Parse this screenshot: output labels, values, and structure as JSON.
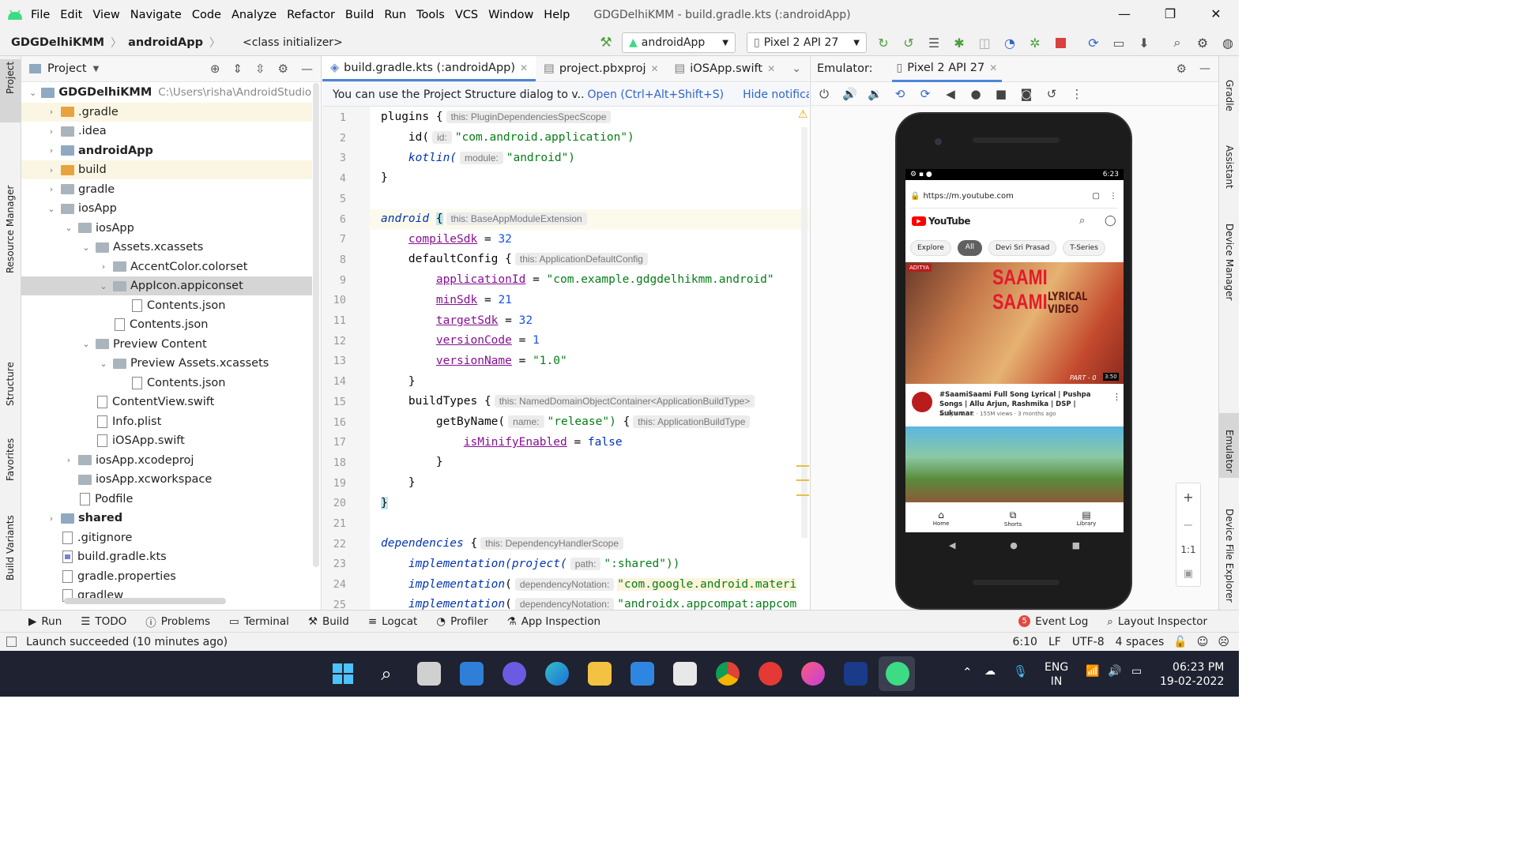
{
  "menu": [
    "File",
    "Edit",
    "View",
    "Navigate",
    "Code",
    "Analyze",
    "Refactor",
    "Build",
    "Run",
    "Tools",
    "VCS",
    "Window",
    "Help"
  ],
  "window_title": "GDGDelhiKMM - build.gradle.kts (:androidApp)",
  "breadcrumb": {
    "project": "GDGDelhiKMM",
    "module": "androidApp",
    "context": "<class initializer>"
  },
  "toolbar": {
    "run_config": "androidApp",
    "device": "Pixel 2 API 27"
  },
  "left_tabs": [
    "Project",
    "Resource Manager",
    "Structure",
    "Favorites",
    "Build Variants"
  ],
  "right_tabs": [
    "Gradle",
    "Assistant",
    "Device Manager",
    "Emulator",
    "Device File Explorer"
  ],
  "project_panel": {
    "title": "Project",
    "tree": [
      {
        "label": "GDGDelhiKMM",
        "path": "C:\\Users\\risha\\AndroidStudioProj",
        "indent": 0,
        "type": "module",
        "bold": true,
        "arrow": "⌄"
      },
      {
        "label": ".gradle",
        "indent": 1,
        "type": "orange",
        "arrow": "›"
      },
      {
        "label": ".idea",
        "indent": 1,
        "type": "folder",
        "arrow": "›"
      },
      {
        "label": "androidApp",
        "indent": 1,
        "type": "module",
        "bold": true,
        "arrow": "›"
      },
      {
        "label": "build",
        "indent": 1,
        "type": "orange",
        "arrow": "›"
      },
      {
        "label": "gradle",
        "indent": 1,
        "type": "folder",
        "arrow": "›"
      },
      {
        "label": "iosApp",
        "indent": 1,
        "type": "folder",
        "arrow": "⌄"
      },
      {
        "label": "iosApp",
        "indent": 2,
        "type": "folder",
        "arrow": "⌄"
      },
      {
        "label": "Assets.xcassets",
        "indent": 3,
        "type": "folder",
        "arrow": "⌄"
      },
      {
        "label": "AccentColor.colorset",
        "indent": 4,
        "type": "folder",
        "arrow": "›"
      },
      {
        "label": "AppIcon.appiconset",
        "indent": 4,
        "type": "folder",
        "arrow": "⌄",
        "selected": true
      },
      {
        "label": "Contents.json",
        "indent": 5,
        "type": "file",
        "arrow": ""
      },
      {
        "label": "Contents.json",
        "indent": 4,
        "type": "file",
        "arrow": ""
      },
      {
        "label": "Preview Content",
        "indent": 3,
        "type": "folder",
        "arrow": "⌄"
      },
      {
        "label": "Preview Assets.xcassets",
        "indent": 4,
        "type": "folder",
        "arrow": "⌄"
      },
      {
        "label": "Contents.json",
        "indent": 5,
        "type": "file",
        "arrow": ""
      },
      {
        "label": "ContentView.swift",
        "indent": 3,
        "type": "file",
        "arrow": ""
      },
      {
        "label": "Info.plist",
        "indent": 3,
        "type": "file",
        "arrow": ""
      },
      {
        "label": "iOSApp.swift",
        "indent": 3,
        "type": "file",
        "arrow": ""
      },
      {
        "label": "iosApp.xcodeproj",
        "indent": 2,
        "type": "folder",
        "arrow": "›"
      },
      {
        "label": "iosApp.xcworkspace",
        "indent": 2,
        "type": "folder",
        "arrow": ""
      },
      {
        "label": "Podfile",
        "indent": 2,
        "type": "file",
        "arrow": ""
      },
      {
        "label": "shared",
        "indent": 1,
        "type": "module",
        "bold": true,
        "arrow": "›"
      },
      {
        "label": ".gitignore",
        "indent": 1,
        "type": "file",
        "arrow": ""
      },
      {
        "label": "build.gradle.kts",
        "indent": 1,
        "type": "kts",
        "arrow": ""
      },
      {
        "label": "gradle.properties",
        "indent": 1,
        "type": "file",
        "arrow": ""
      },
      {
        "label": "gradlew",
        "indent": 1,
        "type": "file",
        "arrow": ""
      }
    ]
  },
  "editor_tabs": [
    "build.gradle.kts (:androidApp)",
    "project.pbxproj",
    "iOSApp.swift"
  ],
  "notification": {
    "text": "You can use the Project Structure dialog to v..",
    "link": "Open (Ctrl+Alt+Shift+S)",
    "hide": "Hide notification"
  },
  "code_hints": {
    "h1": "this: PluginDependenciesSpecScope",
    "h2": "id:",
    "h3": "module:",
    "h6": "this: BaseAppModuleExtension",
    "h8": "this: ApplicationDefaultConfig",
    "h15": "this: NamedDomainObjectContainer<ApplicationBuildType>",
    "h16a": "name:",
    "h16b": "this: ApplicationBuildType",
    "h22": "this: DependencyHandlerScope",
    "h23": "path:",
    "h24": "dependencyNotation:"
  },
  "code": {
    "l1": "plugins {",
    "l2a": "id(",
    "l2b": "\"com.android.application\")",
    "l3a": "kotlin(",
    "l3b": "\"android\")",
    "l4": "}",
    "l6a": "android",
    "l6b": "{",
    "l7a": "compileSdk",
    "l7b": "32",
    "l8": "defaultConfig {",
    "l9a": "applicationId",
    "l9b": "\"com.example.gdgdelhikmm.android\"",
    "l10a": "minSdk",
    "l10b": "21",
    "l11a": "targetSdk",
    "l11b": "32",
    "l12a": "versionCode",
    "l12b": "1",
    "l13a": "versionName",
    "l13b": "\"1.0\"",
    "l14": "}",
    "l15": "buildTypes {",
    "l16a": "getByName(",
    "l16b": "\"release\")",
    "l16c": "{",
    "l17a": "isMinifyEnabled",
    "l17b": "false",
    "l18": "}",
    "l19": "}",
    "l20": "}",
    "l22a": "dependencies",
    "l22b": "{",
    "l23a": "implementation",
    "l23b": "(project(",
    "l23c": "\":shared\"))",
    "l24a": "implementation",
    "l24b": "(",
    "l24c": "\"com.google.android.materi",
    "l25a": "implementation",
    "l25b": "(",
    "l25c": "\"androidx.appcompat:appcom"
  },
  "emulator": {
    "label": "Emulator:",
    "device_tab": "Pixel 2 API 27"
  },
  "phone": {
    "time": "6:23",
    "url": "https://m.youtube.com",
    "brand": "YouTube",
    "chips": [
      "Explore",
      "All",
      "Devi Sri Prasad",
      "T-Series"
    ],
    "thumb_title": "SAAMI SAAMI",
    "thumb_sub": "LYRICAL VIDEO",
    "thumb_brand": "ADITYA",
    "thumb_part": "PART - 0",
    "duration": "3:50",
    "video_title": "#SaamiSaami Full Song Lyrical | Pushpa Songs | Allu Arjun, Rashmika | DSP | Sukumar",
    "video_meta": "Aditya Music · 155M views · 3 months ago",
    "nav": [
      "Home",
      "Shorts",
      "Library"
    ]
  },
  "zoom_label": "1:1",
  "bottom_tools": [
    "Run",
    "TODO",
    "Problems",
    "Terminal",
    "Build",
    "Logcat",
    "Profiler",
    "App Inspection"
  ],
  "event_log": {
    "count": "5",
    "label": "Event Log"
  },
  "layout_inspector": "Layout Inspector",
  "status": {
    "message": "Launch succeeded (10 minutes ago)",
    "pos": "6:10",
    "lf": "LF",
    "enc": "UTF-8",
    "indent": "4 spaces"
  },
  "taskbar": {
    "lang1": "ENG",
    "lang2": "IN",
    "time": "06:23 PM",
    "date": "19-02-2022"
  },
  "colors": {
    "accent": "#4a87d9",
    "youtube_red": "#ff0000",
    "taskbar": "#1f2230"
  }
}
